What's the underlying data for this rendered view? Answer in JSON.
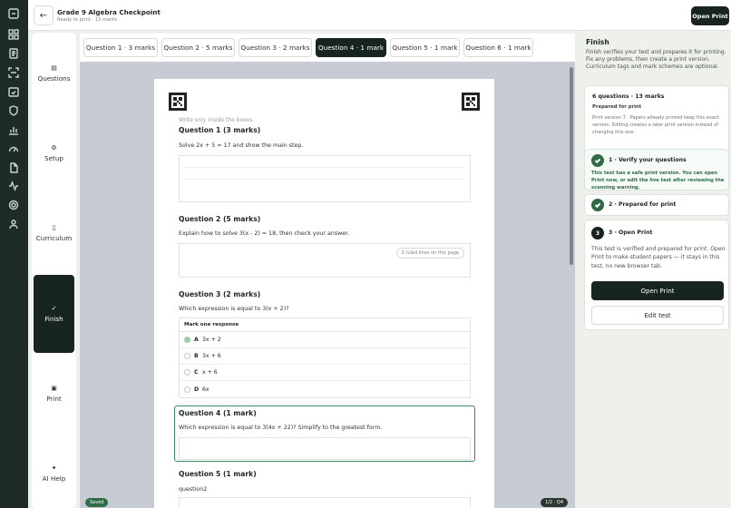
{
  "header": {
    "title": "Grade 9 Algebra Checkpoint",
    "subtitle": "Ready to print · 13 marks",
    "back_icon": "arrow-left-icon",
    "open_print_label": "Open Print"
  },
  "rail": {
    "icons": [
      "dashboard-icon",
      "grid-icon",
      "document-icon",
      "scan-icon",
      "calendar-check-icon",
      "shield-icon",
      "chart-icon",
      "gauge-icon",
      "file-icon",
      "activity-icon",
      "settings-icon",
      "users-icon"
    ]
  },
  "steps": [
    {
      "label": "Questions",
      "icon": "▤",
      "active": false
    },
    {
      "label": "Setup",
      "icon": "⚙",
      "active": false
    },
    {
      "label": "Curriculum",
      "icon": "▯",
      "active": false
    },
    {
      "label": "Finish",
      "icon": "✓",
      "active": true
    },
    {
      "label": "Print",
      "icon": "▣",
      "active": false
    },
    {
      "label": "AI Help",
      "icon": "✦",
      "active": false
    }
  ],
  "tabs": [
    {
      "label": "Question 1 · 3 marks",
      "active": false
    },
    {
      "label": "Question 2 · 5 marks",
      "active": false
    },
    {
      "label": "Question 3 · 2 marks",
      "active": false
    },
    {
      "label": "Question 4 · 1 mark",
      "active": true
    },
    {
      "label": "Question 5 · 1 mark",
      "active": false
    },
    {
      "label": "Question 6 · 1 mark",
      "active": false
    }
  ],
  "sheet": {
    "hint": "Write only inside the boxes.",
    "q1": {
      "heading": "Question 1 (3 marks)",
      "prompt": "Solve 2x + 5 = 17 and show the main step."
    },
    "q2": {
      "heading": "Question 2 (5 marks)",
      "prompt": "Explain how to solve 3(x - 2) = 18, then check your answer.",
      "chip": "2 ruled lines on this page"
    },
    "q3": {
      "heading": "Question 3 (2 marks)",
      "prompt": "Which expression is equal to 3(x + 2)?",
      "mcq_header": "Mark one response",
      "options": [
        {
          "letter": "A",
          "text": "3x + 2",
          "selected": true
        },
        {
          "letter": "B",
          "text": "3x + 6",
          "selected": false
        },
        {
          "letter": "C",
          "text": "x + 6",
          "selected": false
        },
        {
          "letter": "D",
          "text": "6x",
          "selected": false
        }
      ]
    },
    "q4": {
      "heading": "Question 4 (1 mark)",
      "prompt": "Which expression is equal to 3(4x + 22)? Simplify to the greatest form."
    },
    "q5": {
      "heading": "Question 5 (1 mark)",
      "prompt": "question2"
    }
  },
  "badges": {
    "saved": "Saved",
    "page": "1/2 · Q4"
  },
  "panel": {
    "title": "Finish",
    "description": "Finish verifies your test and prepares it for printing. Fix any problems, then create a print version. Curriculum tags and mark schemes are optional.",
    "summary": {
      "title": "6 questions · 13 marks",
      "status": "Prepared for print",
      "note": "Print version 7 · Papers already printed keep this exact version. Editing creates a later print version instead of changing this one."
    },
    "step1": {
      "title": "1 · Verify your questions",
      "note": "This test has a safe print version. You can open Print now, or edit the live test after reviewing the scanning warning."
    },
    "step2": {
      "title": "2 · Prepared for print"
    },
    "step3": {
      "number": "3",
      "title": "3 · Open Print",
      "body": "This test is verified and prepared for print. Open Print to make student papers — it stays in this test, no new browser tab.",
      "primary_label": "Open Print",
      "secondary_label": "Edit test"
    }
  }
}
